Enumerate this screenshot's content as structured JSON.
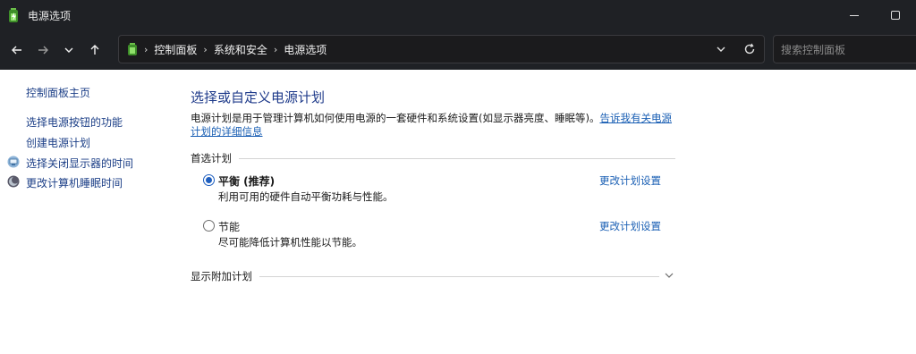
{
  "window": {
    "title": "电源选项",
    "app_icon": "battery-power-icon"
  },
  "nav": {
    "back_icon": "arrow-left-icon",
    "forward_icon": "arrow-right-icon",
    "recent_icon": "chevron-down-icon",
    "up_icon": "arrow-up-icon"
  },
  "address": {
    "crumbs": [
      "控制面板",
      "系统和安全",
      "电源选项"
    ],
    "dropdown_icon": "chevron-down-icon",
    "refresh_icon": "refresh-icon"
  },
  "search": {
    "placeholder": "搜索控制面板"
  },
  "sidebar": {
    "home": "控制面板主页",
    "links": [
      "选择电源按钮的功能",
      "创建电源计划",
      "选择关闭显示器的时间",
      "更改计算机睡眠时间"
    ]
  },
  "main": {
    "heading": "选择或自定义电源计划",
    "description": "电源计划是用于管理计算机如何使用电源的一套硬件和系统设置(如显示器亮度、睡眠等)。",
    "description_link": "告诉我有关电源计划的详细信息",
    "preferred_label": "首选计划",
    "plans": [
      {
        "name": "平衡 (推荐)",
        "desc": "利用可用的硬件自动平衡功耗与性能。",
        "link": "更改计划设置",
        "selected": true
      },
      {
        "name": "节能",
        "desc": "尽可能降低计算机性能以节能。",
        "link": "更改计划设置",
        "selected": false
      }
    ],
    "additional_label": "显示附加计划"
  },
  "colors": {
    "titlebar": "#1f2125",
    "link": "#1a5fb4",
    "heading": "#1e3a8a",
    "radio_selected": "#1f5fbf"
  }
}
